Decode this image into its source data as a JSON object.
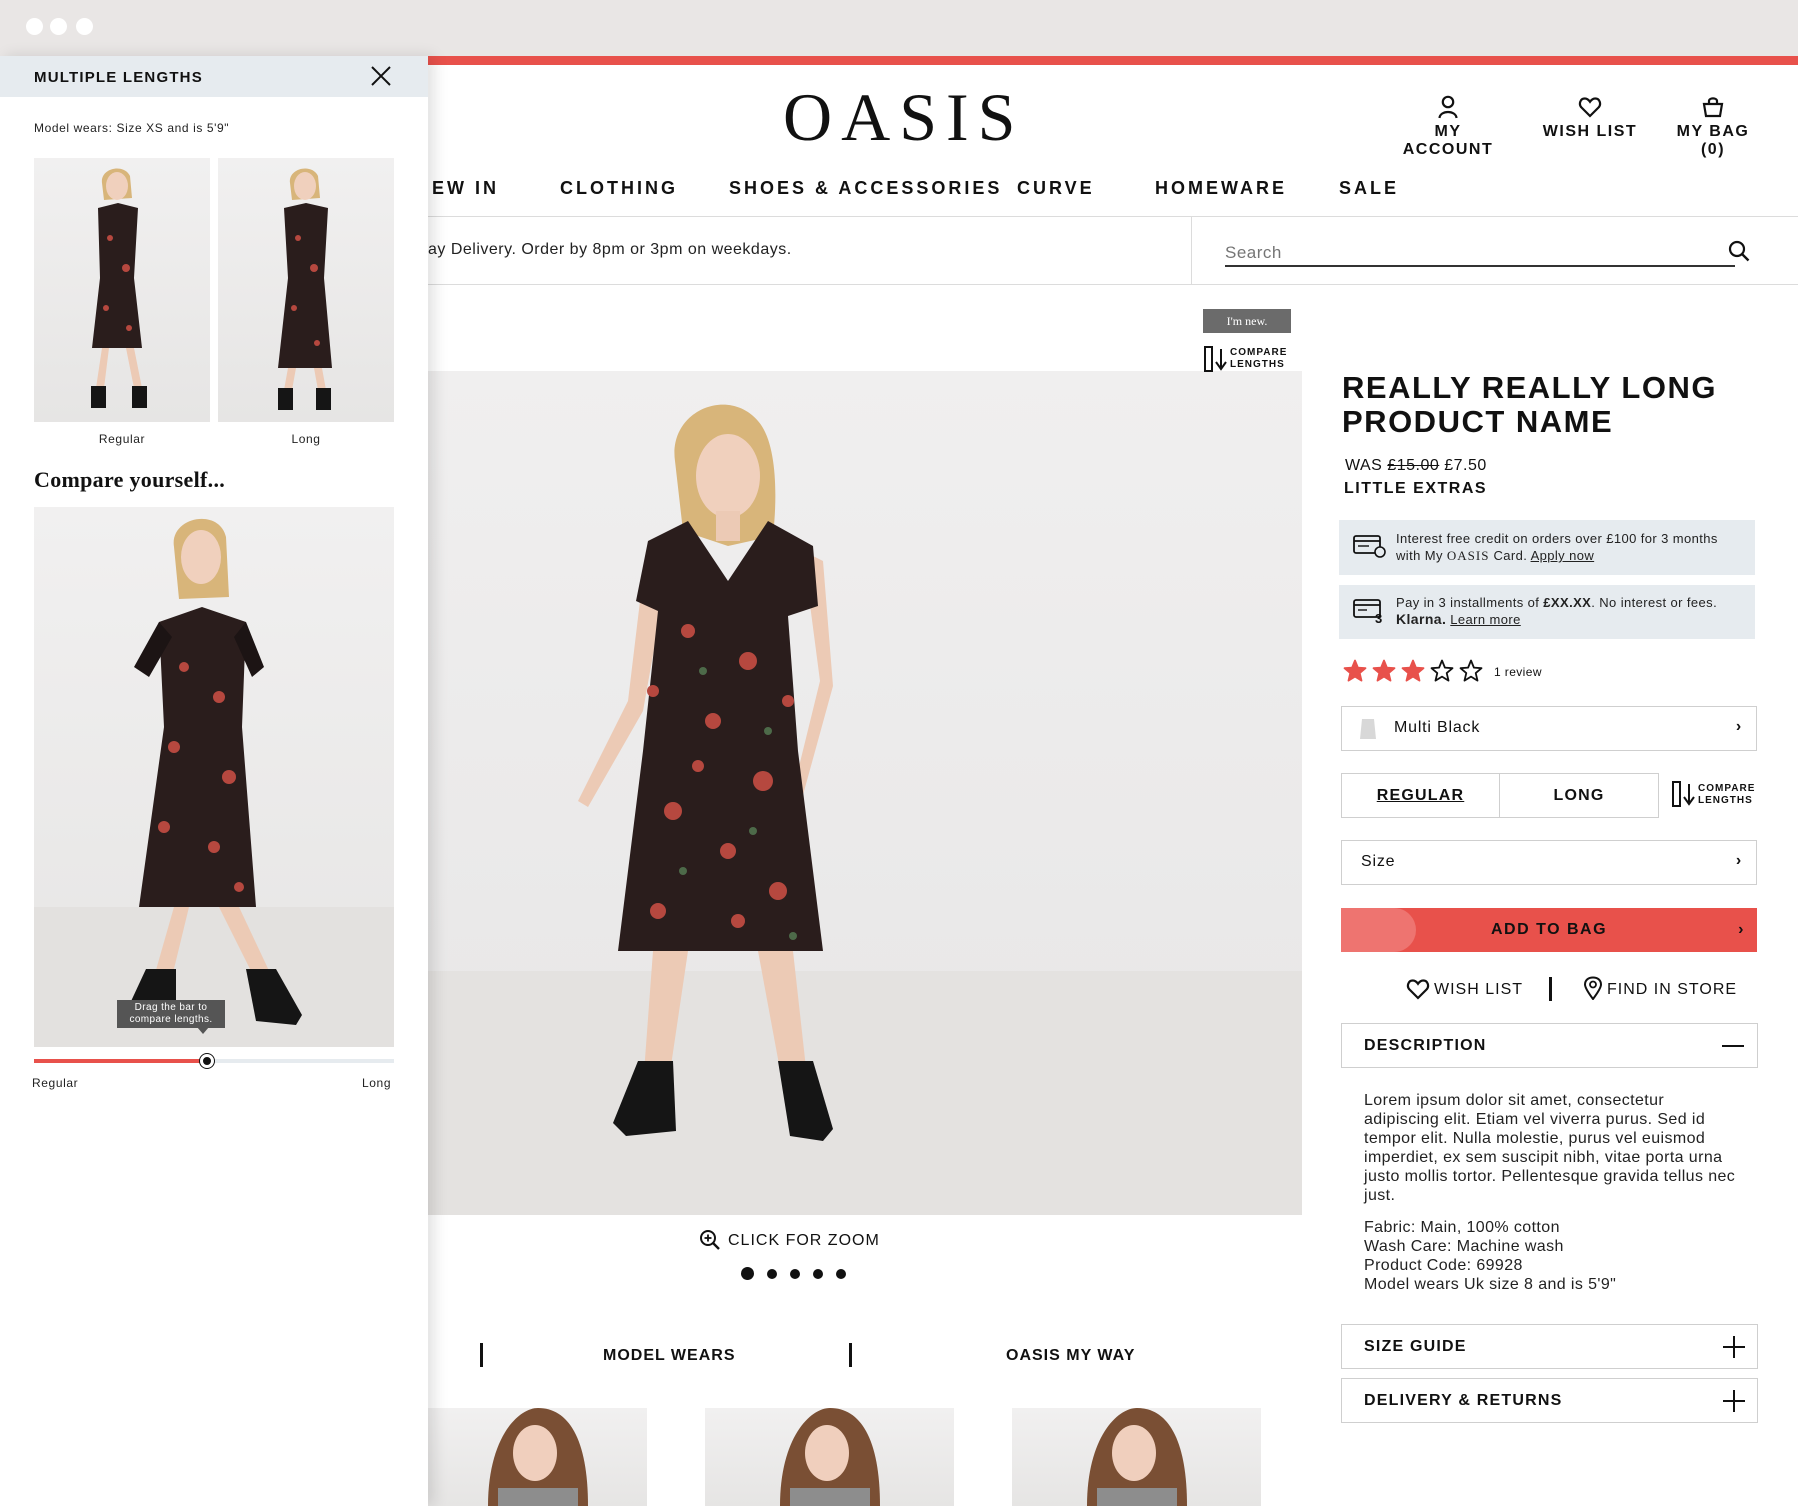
{
  "panel": {
    "title": "MULTIPLE LENGTHS",
    "model_note": "Model wears: Size XS and is 5'9\"",
    "thumbs": [
      {
        "label": "Regular"
      },
      {
        "label": "Long"
      }
    ],
    "compare_title": "Compare yourself...",
    "tooltip": "Drag the bar to compare lengths.",
    "slider": {
      "value": 0.48,
      "left_label": "Regular",
      "right_label": "Long"
    }
  },
  "header": {
    "logo": "OASIS",
    "account_label": "MY ACCOUNT",
    "wishlist_label": "WISH LIST",
    "bag_label": "MY BAG (0)"
  },
  "nav": [
    "EW IN",
    "CLOTHING",
    "SHOES & ACCESSORIES",
    "CURVE",
    "HOMEWARE",
    "SALE"
  ],
  "promo": "ay Delivery. Order by 8pm or 3pm on weekdays.",
  "search": {
    "placeholder": "Search"
  },
  "gallery": {
    "badge_new": "I'm new.",
    "compare_label_1": "COMPARE",
    "compare_label_2": "LENGTHS",
    "zoom_label": "CLICK FOR ZOOM",
    "dots_count": 5,
    "active_dot": 1
  },
  "product": {
    "name_line1": "REALLY REALLY LONG",
    "name_line2": "PRODUCT NAME",
    "was_label": "WAS",
    "was_price": "£15.00",
    "price": "£7.50",
    "collection": "LITTLE EXTRAS",
    "credit": {
      "text_a": "Interest free credit on orders over £100 for 3 months",
      "text_b": "with My",
      "brand": "OASIS",
      "text_c": "Card.",
      "link": "Apply now"
    },
    "klarna": {
      "text_a": "Pay in 3 installments of",
      "amount": "£XX.XX",
      "text_b": ". No interest or fees.",
      "brand": "Klarna.",
      "link": "Learn more"
    },
    "rating": {
      "stars": 3,
      "max": 5,
      "reviews_label": "1 review",
      "star_color": "#e8514b"
    },
    "colour": "Multi Black",
    "length_options": [
      "REGULAR",
      "LONG"
    ],
    "selected_length": "REGULAR",
    "compare_label_1": "COMPARE",
    "compare_label_2": "LENGTHS",
    "size_label": "Size",
    "add_to_bag": "ADD TO BAG",
    "wishlist_label": "WISH LIST",
    "find_store_label": "FIND IN STORE",
    "description_title": "DESCRIPTION",
    "description": "Lorem ipsum dolor sit amet, consectetur adipiscing elit. Etiam vel viverra purus. Sed id tempor elit. Nulla molestie, purus vel euismod imperdiet, ex sem suscipit nibh, vitae porta urna justo mollis tortor. Pellentesque gravida tellus nec just.",
    "details": [
      "Fabric: Main, 100% cotton",
      "Wash Care: Machine wash",
      "Product Code: 69928",
      "Model wears Uk size 8 and is 5'9\""
    ],
    "size_guide": "SIZE GUIDE",
    "delivery": "DELIVERY & RETURNS"
  },
  "tabs": [
    "MODEL WEARS",
    "OASIS MY WAY"
  ],
  "colors": {
    "accent": "#e8514b",
    "info_bg": "#e6ebef"
  }
}
